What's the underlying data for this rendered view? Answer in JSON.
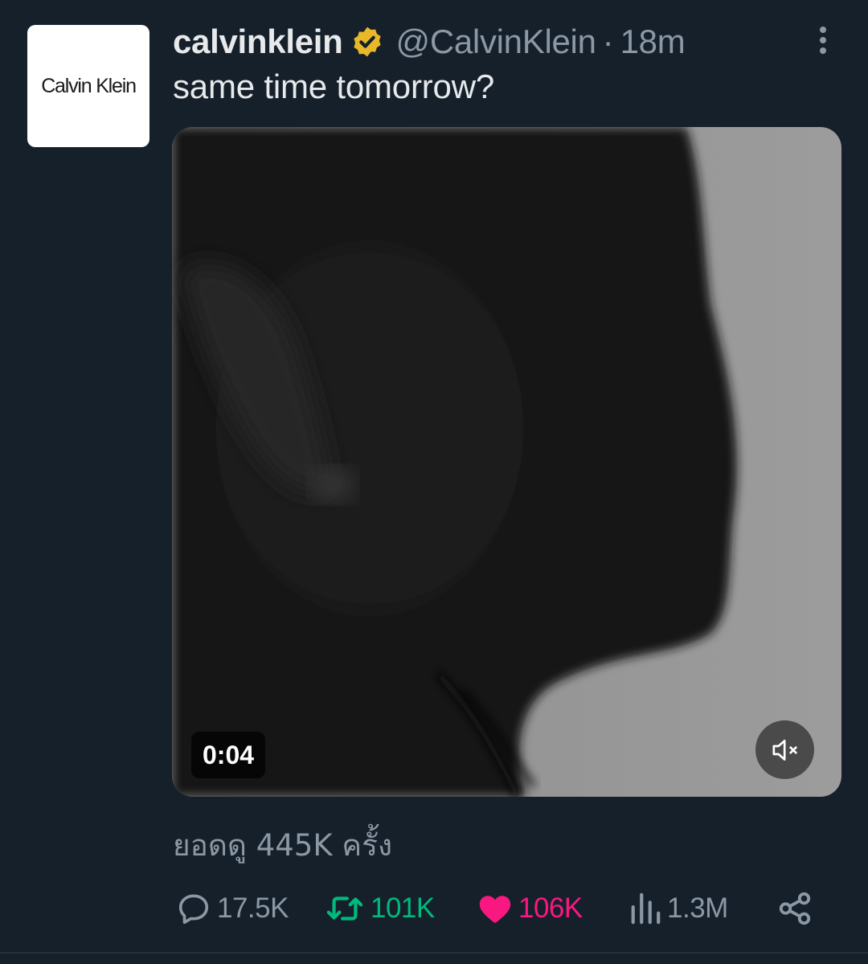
{
  "avatar": {
    "logo_text": "Calvin Klein",
    "icon": "calvin-klein-logo"
  },
  "author": {
    "display_name": "calvinklein",
    "verified_icon": "gold-verified-badge-icon",
    "handle": "@CalvinKlein",
    "separator": "·",
    "time": "18m"
  },
  "more_icon": "more-vertical-icon",
  "tweet": {
    "text": "same time tomorrow?"
  },
  "media": {
    "type": "video",
    "duration": "0:04",
    "mute_icon": "speaker-muted-icon"
  },
  "views_label": "ยอดดู 445K ครั้ง",
  "actions": {
    "reply": {
      "icon": "reply-bubble-icon",
      "count": "17.5K"
    },
    "retweet": {
      "icon": "retweet-icon",
      "count": "101K"
    },
    "like": {
      "icon": "heart-filled-icon",
      "count": "106K"
    },
    "views": {
      "icon": "bar-chart-icon",
      "count": "1.3M"
    },
    "share": {
      "icon": "share-icon"
    }
  },
  "colors": {
    "background": "#15202b",
    "text_primary": "#e7e9ea",
    "text_secondary": "#8b98a5",
    "retweet_green": "#00ba7c",
    "like_pink": "#f91880",
    "verified_gold": "#e8b829"
  }
}
